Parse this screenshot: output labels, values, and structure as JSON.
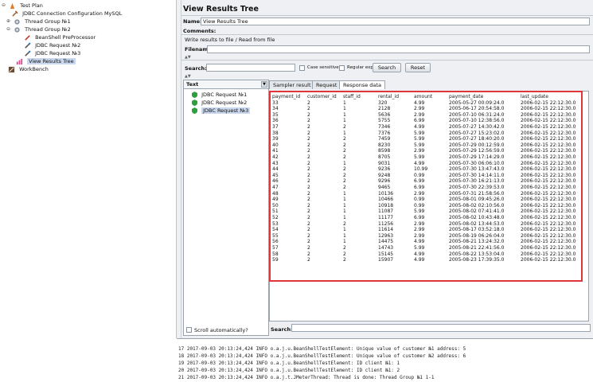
{
  "tree": {
    "items": [
      {
        "label": "Test Plan",
        "icon": "test-plan-icon"
      },
      {
        "label": "JDBC Connection Configuration MySQL",
        "icon": "wrench-icon"
      },
      {
        "label": "Thread Group №1",
        "icon": "gear-icon"
      },
      {
        "label": "Thread Group №2",
        "icon": "gear-icon"
      },
      {
        "label": "BeanShell PreProcessor",
        "icon": "pen-icon"
      },
      {
        "label": "JDBC Request №2",
        "icon": "pipette-icon"
      },
      {
        "label": "JDBC Request №3",
        "icon": "pipette-icon"
      },
      {
        "label": "View Results Tree",
        "icon": "chart-icon"
      },
      {
        "label": "WorkBench",
        "icon": "workbench-icon"
      }
    ]
  },
  "panel": {
    "title": "View Results Tree",
    "name_label": "Name:",
    "name_value": "View Results Tree",
    "comments_label": "Comments:",
    "write_label": "Write results to file / Read from file",
    "filename_label": "Filename",
    "search_label": "Search:",
    "case_sensitive_label": "Case sensitive",
    "regex_label": "Regular exp.",
    "search_button": "Search",
    "reset_button": "Reset"
  },
  "results": {
    "renderer_label": "Text",
    "items": [
      "JDBC Request №1",
      "JDBC Request №2",
      "JDBC Request №3"
    ],
    "scroll_label": "Scroll automatically?",
    "bottom_search_label": "Search:"
  },
  "tabs": [
    "Sampler result",
    "Request",
    "Response data"
  ],
  "response": {
    "headers": [
      "payment_id",
      "customer_id",
      "staff_id",
      "rental_id",
      "amount",
      "payment_date",
      "last_update"
    ],
    "rows": [
      [
        "33",
        "2",
        "1",
        "320",
        "4.99",
        "2005-05-27 00:09:24.0",
        "2006-02-15 22:12:30.0"
      ],
      [
        "34",
        "2",
        "1",
        "2128",
        "2.99",
        "2005-06-17 20:54:58.0",
        "2006-02-15 22:12:30.0"
      ],
      [
        "35",
        "2",
        "1",
        "5636",
        "2.99",
        "2005-07-10 06:31:24.0",
        "2006-02-15 22:12:30.0"
      ],
      [
        "36",
        "2",
        "1",
        "5755",
        "6.99",
        "2005-07-10 12:38:56.0",
        "2006-02-15 22:12:30.0"
      ],
      [
        "37",
        "2",
        "2",
        "7346",
        "4.99",
        "2005-07-27 14:30:42.0",
        "2006-02-15 22:12:30.0"
      ],
      [
        "38",
        "2",
        "1",
        "7376",
        "5.99",
        "2005-07-27 15:23:02.0",
        "2006-02-15 22:12:30.0"
      ],
      [
        "39",
        "2",
        "2",
        "7459",
        "5.99",
        "2005-07-27 18:40:20.0",
        "2006-02-15 22:12:30.0"
      ],
      [
        "40",
        "2",
        "2",
        "8230",
        "5.99",
        "2005-07-29 00:12:59.0",
        "2006-02-15 22:12:30.0"
      ],
      [
        "41",
        "2",
        "2",
        "8598",
        "2.99",
        "2005-07-29 12:56:59.0",
        "2006-02-15 22:12:30.0"
      ],
      [
        "42",
        "2",
        "2",
        "8705",
        "5.99",
        "2005-07-29 17:14:29.0",
        "2006-02-15 22:12:30.0"
      ],
      [
        "43",
        "2",
        "1",
        "9031",
        "4.99",
        "2005-07-30 06:06:10.0",
        "2006-02-15 22:12:30.0"
      ],
      [
        "44",
        "2",
        "2",
        "9236",
        "10.99",
        "2005-07-30 13:47:43.0",
        "2006-02-15 22:12:30.0"
      ],
      [
        "45",
        "2",
        "2",
        "9248",
        "0.99",
        "2005-07-30 14:14:11.0",
        "2006-02-15 22:12:30.0"
      ],
      [
        "46",
        "2",
        "2",
        "9296",
        "6.99",
        "2005-07-30 16:21:13.0",
        "2006-02-15 22:12:30.0"
      ],
      [
        "47",
        "2",
        "2",
        "9465",
        "6.99",
        "2005-07-30 22:39:53.0",
        "2006-02-15 22:12:30.0"
      ],
      [
        "48",
        "2",
        "1",
        "10136",
        "2.99",
        "2005-07-31 21:58:56.0",
        "2006-02-15 22:12:30.0"
      ],
      [
        "49",
        "2",
        "1",
        "10466",
        "0.99",
        "2005-08-01 09:45:26.0",
        "2006-02-15 22:12:30.0"
      ],
      [
        "50",
        "2",
        "1",
        "10918",
        "0.99",
        "2005-08-02 02:10:56.0",
        "2006-02-15 22:12:30.0"
      ],
      [
        "51",
        "2",
        "1",
        "11087",
        "5.99",
        "2005-08-02 07:41:41.0",
        "2006-02-15 22:12:30.0"
      ],
      [
        "52",
        "2",
        "1",
        "11177",
        "6.99",
        "2005-08-02 10:43:48.0",
        "2006-02-15 22:12:30.0"
      ],
      [
        "53",
        "2",
        "2",
        "11256",
        "2.99",
        "2005-08-02 13:44:53.0",
        "2006-02-15 22:12:30.0"
      ],
      [
        "54",
        "2",
        "1",
        "11614",
        "2.99",
        "2005-08-17 03:52:18.0",
        "2006-02-15 22:12:30.0"
      ],
      [
        "55",
        "2",
        "1",
        "12963",
        "2.99",
        "2005-08-19 06:26:04.0",
        "2006-02-15 22:12:30.0"
      ],
      [
        "56",
        "2",
        "1",
        "14475",
        "4.99",
        "2005-08-21 13:24:32.0",
        "2006-02-15 22:12:30.0"
      ],
      [
        "57",
        "2",
        "2",
        "14743",
        "5.99",
        "2005-08-21 22:41:56.0",
        "2006-02-15 22:12:30.0"
      ],
      [
        "58",
        "2",
        "2",
        "15145",
        "4.99",
        "2005-08-22 13:53:04.0",
        "2006-02-15 22:12:30.0"
      ],
      [
        "59",
        "2",
        "2",
        "15907",
        "4.99",
        "2005-08-23 17:39:35.0",
        "2006-02-15 22:12:30.0"
      ]
    ]
  },
  "log": {
    "lines": [
      "17 2017-09-03 20:13:24,424 INFO o.a.j.u.BeanShellTestElement:  Unique value of customer №1 address:  5",
      "18 2017-09-03 20:13:24,424 INFO o.a.j.u.BeanShellTestElement:  Unique value of customer №2 address:  6",
      "19 2017-09-03 20:13:24,424 INFO o.a.j.u.BeanShellTestElement:  ID client №1:  1",
      "20 2017-09-03 20:13:24,424 INFO o.a.j.u.BeanShellTestElement:  ID client №1:  2",
      "21 2017-09-03 20:13:24,424 INFO o.a.j.t.JMeterThread: Thread is done: Thread Group №1 1-1"
    ]
  },
  "colors": {
    "highlight_border": "#e0363a",
    "selection": "#c9d8ee",
    "panel_bg": "#eef0f3"
  }
}
